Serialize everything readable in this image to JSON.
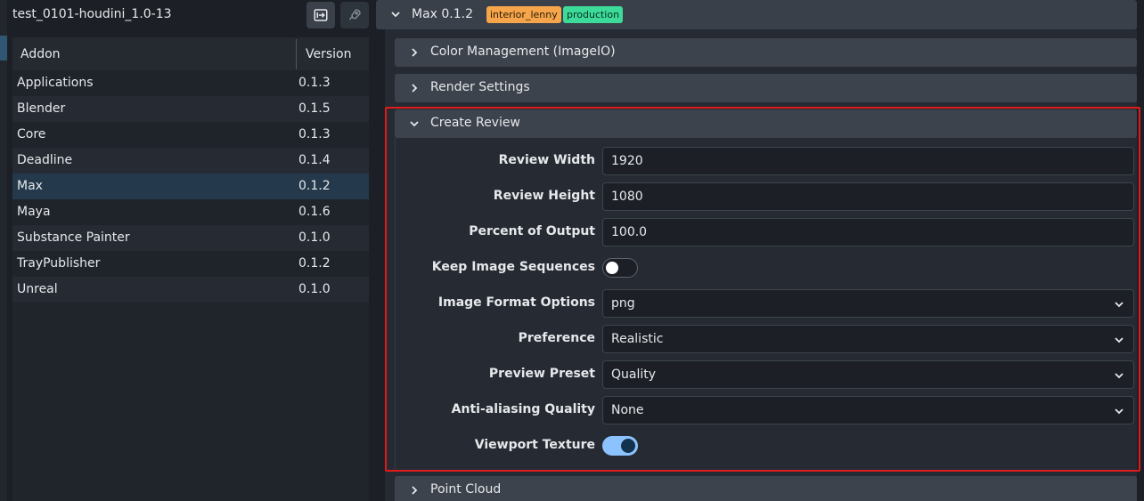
{
  "project": {
    "title": "test_0101-houdini_1.0-13",
    "login_icon": "login-icon",
    "launch_icon": "rocket-icon"
  },
  "addons_table": {
    "columns": {
      "addon": "Addon",
      "version": "Version"
    },
    "rows": [
      {
        "name": "Applications",
        "version": "0.1.3"
      },
      {
        "name": "Blender",
        "version": "0.1.5"
      },
      {
        "name": "Core",
        "version": "0.1.3"
      },
      {
        "name": "Deadline",
        "version": "0.1.4"
      },
      {
        "name": "Max",
        "version": "0.1.2",
        "selected": true
      },
      {
        "name": "Maya",
        "version": "0.1.6"
      },
      {
        "name": "Substance Painter",
        "version": "0.1.0"
      },
      {
        "name": "TrayPublisher",
        "version": "0.1.2"
      },
      {
        "name": "Unreal",
        "version": "0.1.0"
      }
    ]
  },
  "addon_header": {
    "title": "Max 0.1.2",
    "badges": [
      "interior_lenny",
      "production"
    ],
    "badge_colors": [
      "#f6a54b",
      "#3ddb9a"
    ]
  },
  "sections": {
    "color_management": "Color Management (ImageIO)",
    "render_settings": "Render Settings",
    "create_review": "Create Review",
    "point_cloud": "Point Cloud"
  },
  "create_review": {
    "review_width": {
      "label": "Review Width",
      "value": "1920"
    },
    "review_height": {
      "label": "Review Height",
      "value": "1080"
    },
    "percent_output": {
      "label": "Percent of Output",
      "value": "100.0"
    },
    "keep_sequences": {
      "label": "Keep Image Sequences",
      "value": false
    },
    "image_format": {
      "label": "Image Format Options",
      "value": "png"
    },
    "preference": {
      "label": "Preference",
      "value": "Realistic"
    },
    "preview_preset": {
      "label": "Preview Preset",
      "value": "Quality"
    },
    "anti_aliasing": {
      "label": "Anti-aliasing Quality",
      "value": "None"
    },
    "viewport_texture": {
      "label": "Viewport Texture",
      "value": true
    }
  },
  "colors": {
    "accent": "#8cc3ff",
    "highlight": "#e01a1a",
    "selected_row": "#243a4c"
  }
}
